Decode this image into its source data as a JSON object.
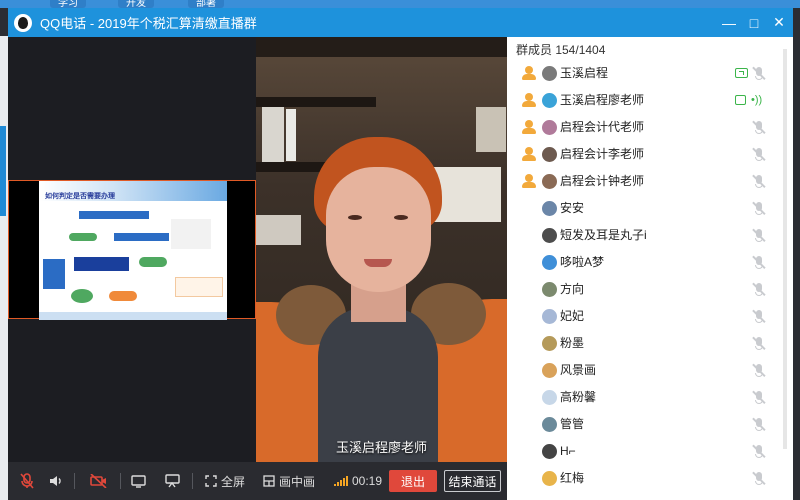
{
  "window": {
    "title": "QQ电话 - 2019年个税汇算清缴直播群"
  },
  "background": {
    "tabs": [
      "学习",
      "开发",
      "部署"
    ]
  },
  "titlebar_controls": {
    "minimize": "—",
    "maximize": "□",
    "close": "✕"
  },
  "screen_share": {
    "slide_title": "如何判定是否需要办理"
  },
  "video": {
    "speaker_name": "玉溪启程廖老师"
  },
  "toolbar": {
    "fullscreen_label": "全屏",
    "pip_label": "画中画",
    "timer": "00:19",
    "exit_label": "退出",
    "end_call_label": "结束通话"
  },
  "members": {
    "header": "群成员 154/1404",
    "items": [
      {
        "name": "玉溪启程",
        "status": "share",
        "admin": true,
        "avatar_color": "#7a7a7a"
      },
      {
        "name": "玉溪启程廖老师",
        "status": "video",
        "admin": true,
        "avatar_color": "#3aa3d8"
      },
      {
        "name": "启程会计代老师",
        "status": "muted",
        "admin": true,
        "avatar_color": "#b07a9a"
      },
      {
        "name": "启程会计李老师",
        "status": "muted",
        "admin": true,
        "avatar_color": "#6d5a4f"
      },
      {
        "name": "启程会计钟老师",
        "status": "muted",
        "admin": true,
        "avatar_color": "#8a6a55"
      },
      {
        "name": "安安",
        "status": "muted",
        "admin": false,
        "avatar_color": "#6b86a8"
      },
      {
        "name": "短发及耳是丸子i",
        "status": "muted",
        "admin": false,
        "avatar_color": "#4d4d4d"
      },
      {
        "name": "哆啦A梦",
        "status": "muted",
        "admin": false,
        "avatar_color": "#3f8fd8"
      },
      {
        "name": "方向",
        "status": "muted",
        "admin": false,
        "avatar_color": "#7c8a6e"
      },
      {
        "name": "妃妃",
        "status": "muted",
        "admin": false,
        "avatar_color": "#a6b8d6"
      },
      {
        "name": "粉墨",
        "status": "muted",
        "admin": false,
        "avatar_color": "#b59a5a"
      },
      {
        "name": "风景画",
        "status": "muted",
        "admin": false,
        "avatar_color": "#d9a25a"
      },
      {
        "name": "高粉馨",
        "status": "muted",
        "admin": false,
        "avatar_color": "#c7d7e8"
      },
      {
        "name": "管管",
        "status": "muted",
        "admin": false,
        "avatar_color": "#6b8a9a"
      },
      {
        "name": "H⌐",
        "status": "muted",
        "admin": false,
        "avatar_color": "#444444"
      },
      {
        "name": "红梅",
        "status": "muted",
        "admin": false,
        "avatar_color": "#e8b44a"
      }
    ]
  },
  "colors": {
    "titlebar": "#1e92dc",
    "exit_button": "#e0483b",
    "active_status": "#3bb54a",
    "muted_icon": "#c9cbcf"
  }
}
